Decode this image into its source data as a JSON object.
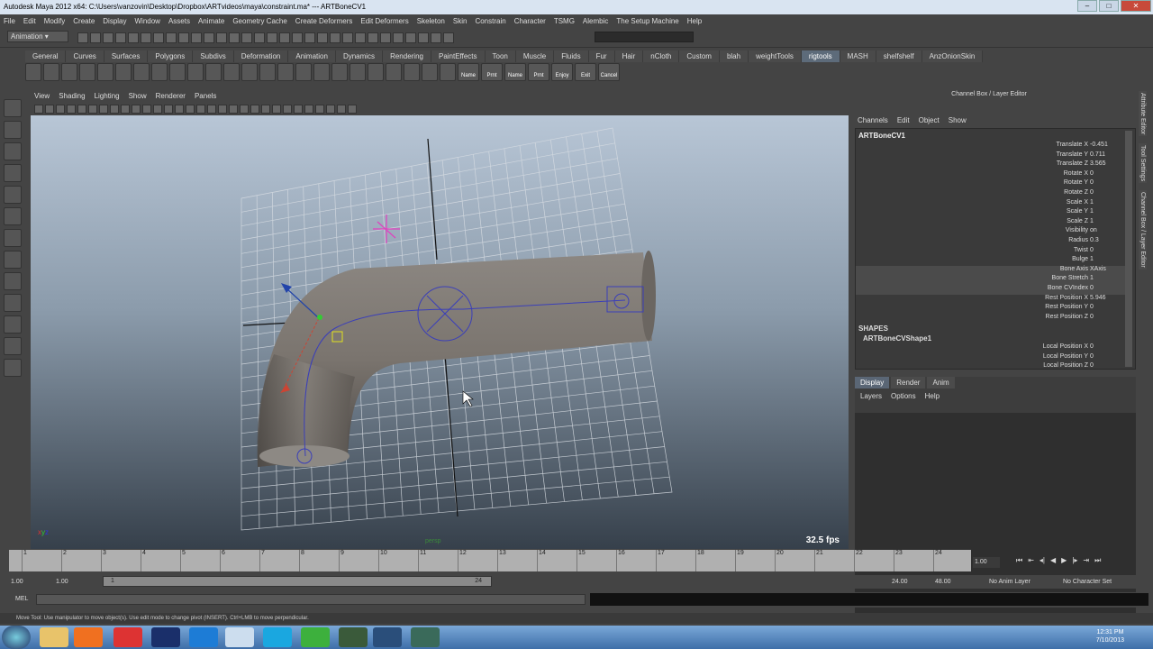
{
  "window": {
    "title": "Autodesk Maya 2012 x64: C:\\Users\\vanzovin\\Desktop\\Dropbox\\ARTvideos\\maya\\constraint.ma*  ---  ARTBoneCV1"
  },
  "menubar": [
    "File",
    "Edit",
    "Modify",
    "Create",
    "Display",
    "Window",
    "Assets",
    "Animate",
    "Geometry Cache",
    "Create Deformers",
    "Edit Deformers",
    "Skeleton",
    "Skin",
    "Constrain",
    "Character",
    "TSMG",
    "Alembic",
    "The Setup Machine",
    "Help"
  ],
  "statusline": {
    "mode": "Animation"
  },
  "shelf_tabs": [
    "General",
    "Curves",
    "Surfaces",
    "Polygons",
    "Subdivs",
    "Deformation",
    "Animation",
    "Dynamics",
    "Rendering",
    "PaintEffects",
    "Toon",
    "Muscle",
    "Fluids",
    "Fur",
    "Hair",
    "nCloth",
    "Custom",
    "blah",
    "weightTools",
    "rigtools",
    "MASH",
    "shelfshelf",
    "AnzOnionSkin"
  ],
  "shelf_active": "rigtools",
  "shelf_icon_labels": [
    "Name",
    "Prnt",
    "Name",
    "Prnt",
    "Enjoy",
    "Exit",
    "Cancel"
  ],
  "viewport": {
    "menu": [
      "View",
      "Shading",
      "Lighting",
      "Show",
      "Renderer",
      "Panels"
    ],
    "fps": "32.5 fps",
    "camera": "persp"
  },
  "channel_box": {
    "title": "Channel Box / Layer Editor",
    "menu": [
      "Channels",
      "Edit",
      "Object",
      "Show"
    ],
    "object": "ARTBoneCV1",
    "channels": [
      {
        "name": "Translate X",
        "value": "-0.451"
      },
      {
        "name": "Translate Y",
        "value": "0.711"
      },
      {
        "name": "Translate Z",
        "value": "3.565"
      },
      {
        "name": "Rotate X",
        "value": "0"
      },
      {
        "name": "Rotate Y",
        "value": "0"
      },
      {
        "name": "Rotate Z",
        "value": "0"
      },
      {
        "name": "Scale X",
        "value": "1"
      },
      {
        "name": "Scale Y",
        "value": "1"
      },
      {
        "name": "Scale Z",
        "value": "1"
      },
      {
        "name": "Visibility",
        "value": "on"
      },
      {
        "name": "Radius",
        "value": "0.3"
      },
      {
        "name": "Twist",
        "value": "0"
      },
      {
        "name": "Bulge",
        "value": "1"
      },
      {
        "name": "Bone Axis",
        "value": "XAxis"
      },
      {
        "name": "Bone Stretch",
        "value": "1"
      },
      {
        "name": "Bone CVIndex",
        "value": "0"
      },
      {
        "name": "Rest Position X",
        "value": "5.946"
      },
      {
        "name": "Rest Position Y",
        "value": "0"
      },
      {
        "name": "Rest Position Z",
        "value": "0"
      }
    ],
    "shapes_header": "SHAPES",
    "shape_object": "ARTBoneCVShape1",
    "shape_channels": [
      {
        "name": "Local Position X",
        "value": "0"
      },
      {
        "name": "Local Position Y",
        "value": "0"
      },
      {
        "name": "Local Position Z",
        "value": "0"
      }
    ]
  },
  "layer_editor": {
    "tabs": [
      "Display",
      "Render",
      "Anim"
    ],
    "active_tab": "Display",
    "menu": [
      "Layers",
      "Options",
      "Help"
    ]
  },
  "side_tabs": [
    "Attribute Editor",
    "Tool Settings",
    "Channel Box / Layer Editor"
  ],
  "time_slider": {
    "ticks": [
      "1",
      "2",
      "3",
      "4",
      "5",
      "6",
      "7",
      "8",
      "9",
      "10",
      "11",
      "12",
      "13",
      "14",
      "15",
      "16",
      "17",
      "18",
      "19",
      "20",
      "21",
      "22",
      "23",
      "24"
    ],
    "current": "1.00"
  },
  "range": {
    "start": "1.00",
    "inner_start": "1.00",
    "slider_start": "1",
    "slider_end": "24",
    "end": "24.00",
    "total_end": "48.00",
    "anim_layer": "No Anim Layer",
    "character": "No Character Set"
  },
  "mel": {
    "label": "MEL"
  },
  "help_line": "Move Tool: Use manipulator to move object(s). Use edit mode to change pivot (INSERT). Ctrl+LMB to move perpendicular.",
  "taskbar": {
    "time": "12:31 PM",
    "date": "7/10/2013"
  }
}
